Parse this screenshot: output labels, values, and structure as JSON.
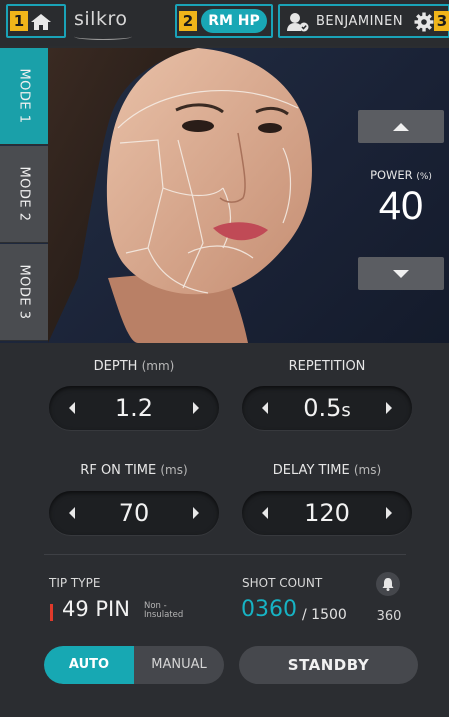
{
  "header": {
    "home_callout_number": "1",
    "logo_text": "silkro",
    "mode_callout_number": "2",
    "mode_label": "RM HP",
    "user_name": "BENJAMINEN",
    "settings_callout_number": "3"
  },
  "mode_tabs": [
    {
      "label": "MODE 1",
      "active": true
    },
    {
      "label": "MODE 2",
      "active": false
    },
    {
      "label": "MODE 3",
      "active": false
    }
  ],
  "power": {
    "label": "POWER",
    "unit": "(%)",
    "value": "40"
  },
  "params": {
    "depth": {
      "label": "DEPTH",
      "unit": "(mm)",
      "value": "1.2"
    },
    "repetition": {
      "label": "REPETITION",
      "value": "0.5",
      "suffix": "s"
    },
    "rf_on_time": {
      "label": "RF ON TIME",
      "unit": "(ms)",
      "value": "70"
    },
    "delay_time": {
      "label": "DELAY TIME",
      "unit": "(ms)",
      "value": "120"
    }
  },
  "tip": {
    "label": "TIP TYPE",
    "value": "49 PIN",
    "sub_line1": "Non -",
    "sub_line2": "Insulated"
  },
  "shot": {
    "label": "SHOT COUNT",
    "value": "0360",
    "total": "/ 1500",
    "bell_count": "360"
  },
  "controls": {
    "auto_label": "AUTO",
    "manual_label": "MANUAL",
    "standby_label": "STANDBY"
  },
  "colors": {
    "accent": "#1aa3b8",
    "callout_badge": "#f0b51a",
    "tip_marker": "#e03a2b"
  }
}
